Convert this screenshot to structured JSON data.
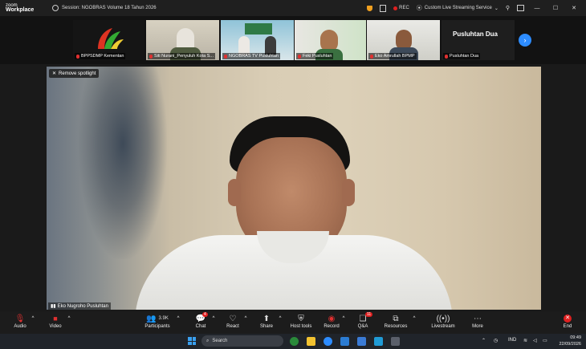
{
  "app": {
    "logo_line1": "zoom",
    "logo_line2": "Workplace"
  },
  "titlebar": {
    "session_title": "Session: NGOBRAS Volume 18 Tahun 2026",
    "rec_label": "REC",
    "streaming_label": "Custom Live Streaming Service",
    "min_glyph": "—",
    "max_glyph": "☐",
    "close_glyph": "✕"
  },
  "gallery": {
    "tiles": [
      {
        "name": "BPPSDMP Kementan"
      },
      {
        "name": "Siti Nurani_Penyuluh Kota S..."
      },
      {
        "name": "NGOBRAS TV Pusluhtan"
      },
      {
        "name": "Feki Pusluhtan"
      },
      {
        "name": "Eko Amrullah BPMP"
      },
      {
        "name": "Pusluhtan Dua"
      }
    ],
    "tile6_big_text": "Pusluhtan Dua",
    "next_glyph": "›"
  },
  "spotlight": {
    "remove_label": "Remove spotlight",
    "speaker_name": "Eko Nugroho Pusluhtan"
  },
  "toolbar": {
    "audio": "Audio",
    "video": "Video",
    "participants": "Participants",
    "participants_count": "3.9K",
    "chat": "Chat",
    "chat_badge": "4",
    "react": "React",
    "share": "Share",
    "host_tools": "Host tools",
    "record": "Record",
    "qa": "Q&A",
    "qa_badge": "11",
    "resources": "Resources",
    "livestream": "Livestream",
    "more": "More",
    "end": "End"
  },
  "taskbar": {
    "search_placeholder": "Search",
    "lang": "IND",
    "time": "09:49",
    "date": "22/09/2026"
  }
}
